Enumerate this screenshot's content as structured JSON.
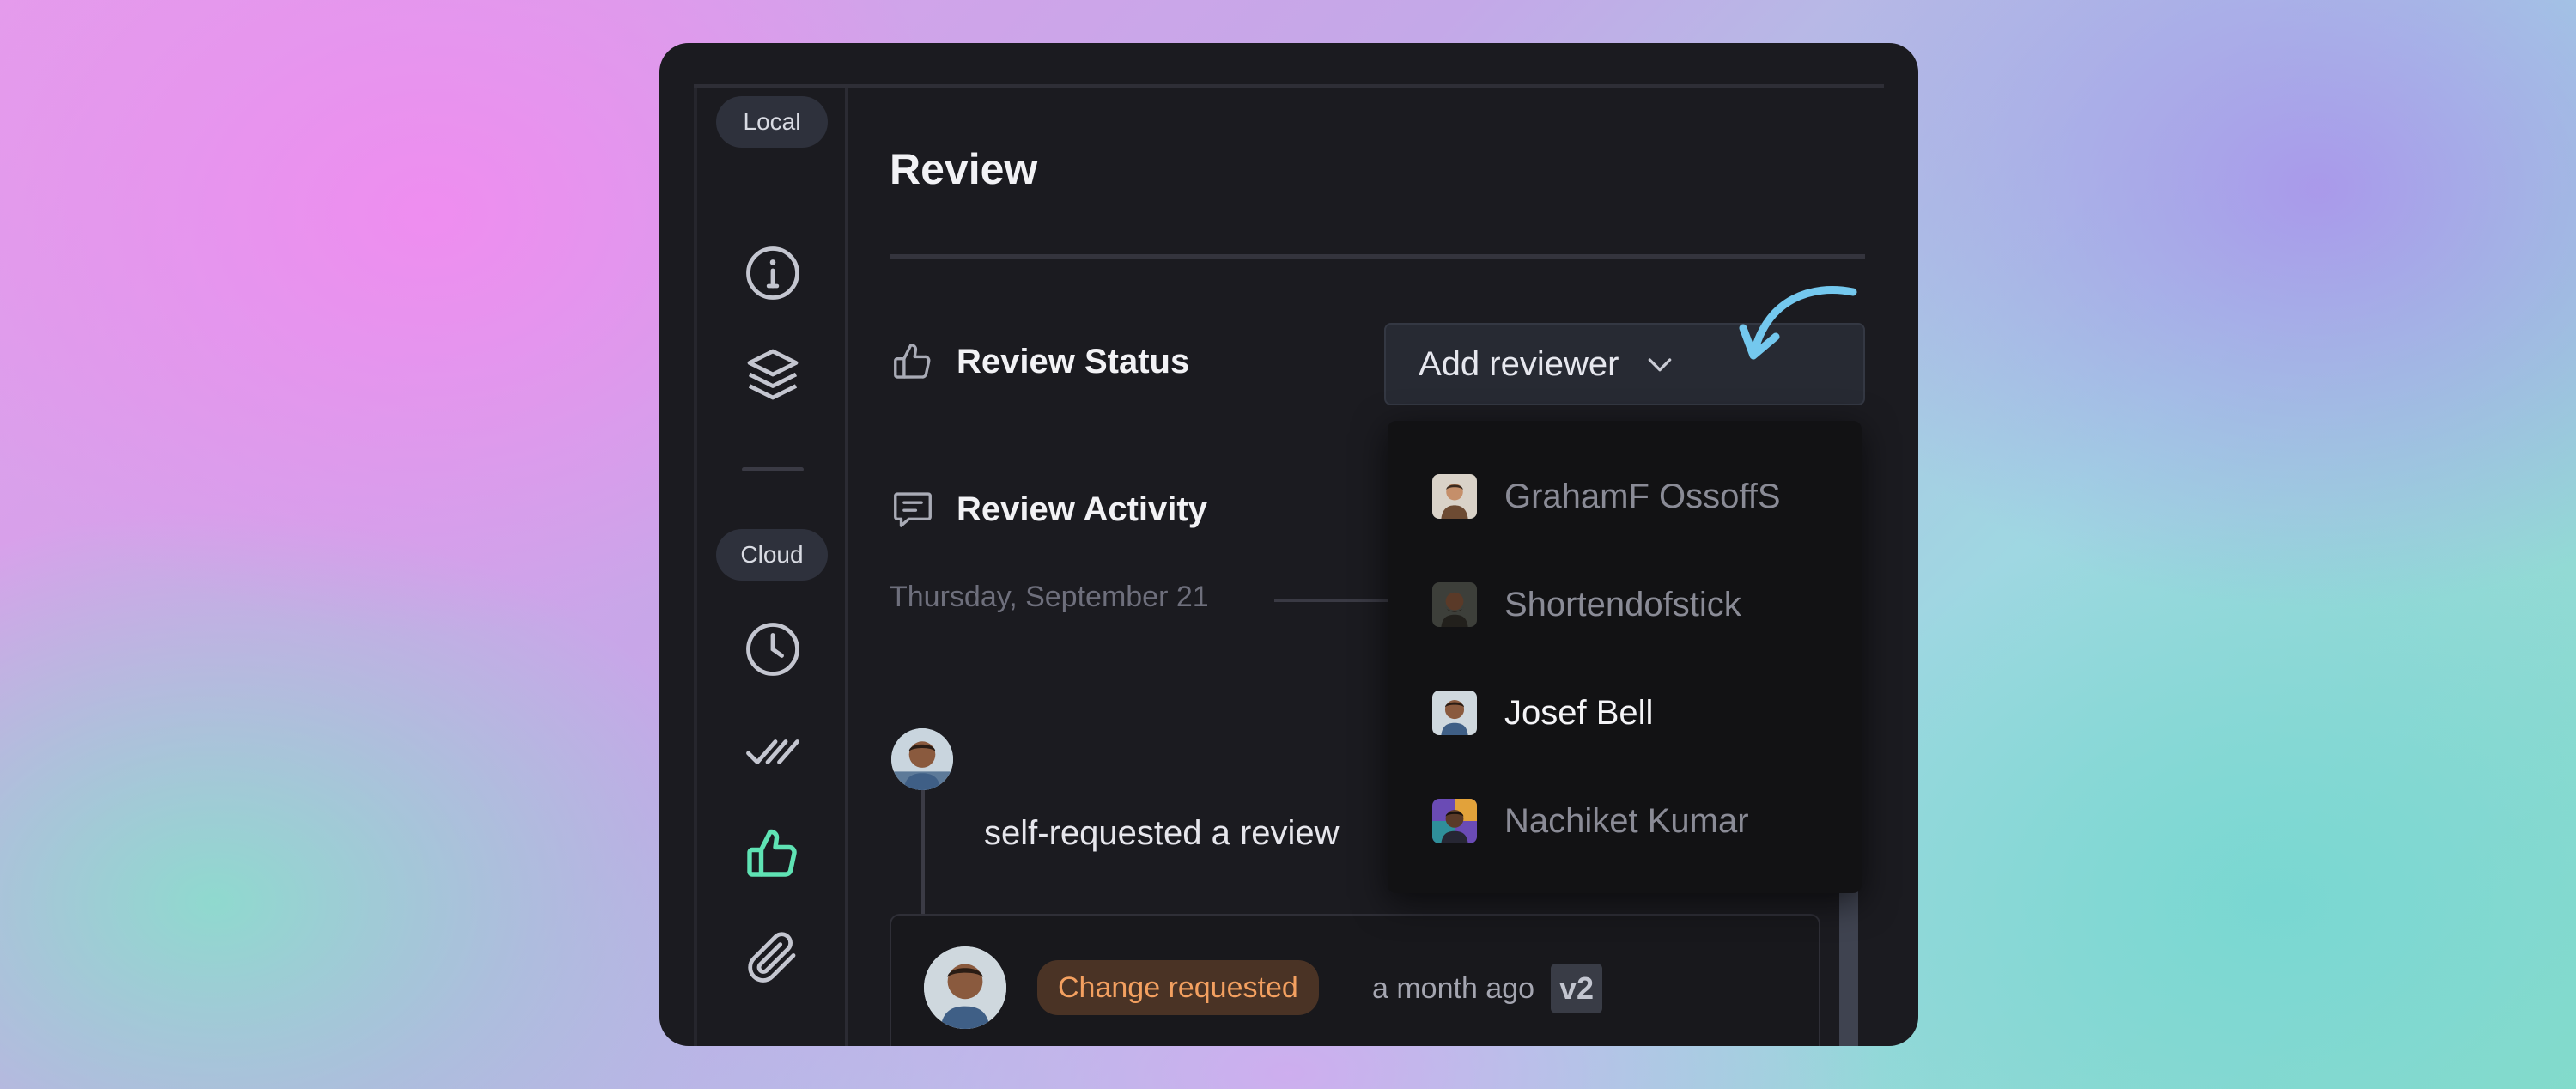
{
  "sidebar": {
    "local_label": "Local",
    "cloud_label": "Cloud",
    "local_icons": [
      "info-icon",
      "layers-icon"
    ],
    "cloud_icons": [
      "clock-icon",
      "double-check-icon",
      "thumbs-up-icon",
      "paperclip-icon"
    ],
    "active_icon": "thumbs-up-icon"
  },
  "header": {
    "title": "Review"
  },
  "review_status": {
    "label": "Review Status",
    "icon": "thumbs-up-icon",
    "add_reviewer_label": "Add reviewer"
  },
  "review_activity": {
    "label": "Review Activity",
    "icon": "comment-icon",
    "date": "Thursday, September 21",
    "event_text": "self-requested a review",
    "card": {
      "status": "Change requested",
      "time": "a month ago",
      "version": "v2"
    }
  },
  "reviewer_dropdown": {
    "items": [
      {
        "name": "GrahamF OssoffS",
        "active": false
      },
      {
        "name": "Shortendofstick",
        "active": false
      },
      {
        "name": "Josef Bell",
        "active": true
      },
      {
        "name": "Nachiket Kumar",
        "active": false
      }
    ]
  },
  "colors": {
    "accent_green": "#5fe3b4",
    "arrow_blue": "#74c8ee",
    "change_requested": "#f3a060"
  }
}
